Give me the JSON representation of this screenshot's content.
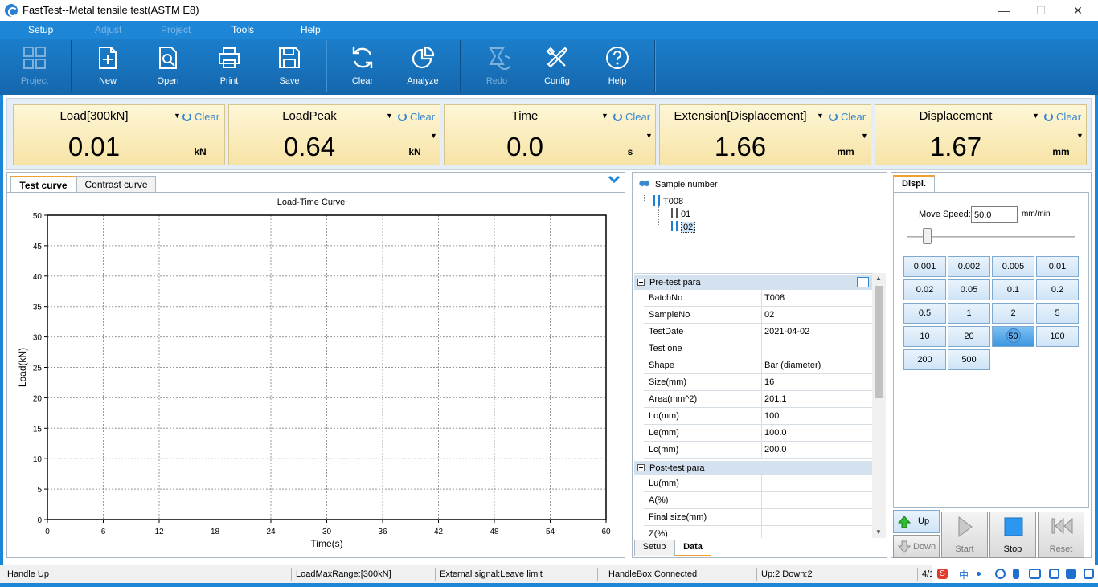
{
  "window": {
    "title": "FastTest--Metal tensile test(ASTM E8)",
    "minimize": "—",
    "maximize": "☐",
    "close": "✕"
  },
  "menu": [
    {
      "label": "Setup",
      "enabled": true
    },
    {
      "label": "Adjust",
      "enabled": false
    },
    {
      "label": "Project",
      "enabled": false
    },
    {
      "label": "Tools",
      "enabled": true
    },
    {
      "label": "Help",
      "enabled": true
    }
  ],
  "toolbar": {
    "project": "Project",
    "new": "New",
    "open": "Open",
    "print": "Print",
    "save": "Save",
    "clear": "Clear",
    "analyze": "Analyze",
    "redo": "Redo",
    "config": "Config",
    "help": "Help"
  },
  "meters": [
    {
      "name": "Load[300kN]",
      "value": "0.01",
      "unit": "kN",
      "clear": "Clear"
    },
    {
      "name": "LoadPeak",
      "value": "0.64",
      "unit": "kN",
      "clear": "Clear"
    },
    {
      "name": "Time",
      "value": "0.0",
      "unit": "s",
      "clear": "Clear"
    },
    {
      "name": "Extension[Displacement]",
      "value": "1.66",
      "unit": "mm",
      "clear": "Clear"
    },
    {
      "name": "Displacement",
      "value": "1.67",
      "unit": "mm",
      "clear": "Clear"
    }
  ],
  "chart_tabs": {
    "test_curve": "Test curve",
    "contrast_curve": "Contrast curve"
  },
  "chart_data": {
    "type": "line",
    "title": "Load-Time Curve",
    "xlabel": "Time(s)",
    "ylabel": "Load(kN)",
    "xlim": [
      0,
      60
    ],
    "ylim": [
      0,
      50
    ],
    "xticks": [
      0,
      6,
      12,
      18,
      24,
      30,
      36,
      42,
      48,
      54,
      60
    ],
    "yticks": [
      0,
      5,
      10,
      15,
      20,
      25,
      30,
      35,
      40,
      45,
      50
    ],
    "grid": true,
    "series": []
  },
  "sample_tree": {
    "root": "Sample number",
    "batch": "T008",
    "samples": [
      "01",
      "02"
    ],
    "selected": "02"
  },
  "pretest": {
    "title": "Pre-test para",
    "rows": [
      {
        "key": "BatchNo",
        "value": "T008"
      },
      {
        "key": "SampleNo",
        "value": "02"
      },
      {
        "key": "TestDate",
        "value": "2021-04-02"
      },
      {
        "key": "Test one",
        "value": ""
      },
      {
        "key": "Shape",
        "value": "Bar (diameter)"
      },
      {
        "key": "Size(mm)",
        "value": "16"
      },
      {
        "key": "Area(mm^2)",
        "value": "201.1"
      },
      {
        "key": "Lo(mm)",
        "value": "100"
      },
      {
        "key": "Le(mm)",
        "value": "100.0"
      },
      {
        "key": "Lc(mm)",
        "value": "200.0"
      }
    ]
  },
  "posttest": {
    "title": "Post-test para",
    "rows": [
      {
        "key": "Lu(mm)",
        "value": ""
      },
      {
        "key": "A(%)",
        "value": ""
      },
      {
        "key": "Final size(mm)",
        "value": ""
      },
      {
        "key": "Z(%)",
        "value": ""
      }
    ]
  },
  "mid_tabs": {
    "setup": "Setup",
    "data": "Data"
  },
  "displ": {
    "tab": "Displ.",
    "speed_label": "Move Speed:",
    "speed_value": "50.0",
    "speed_unit": "mm/min",
    "speed_slider": 0.1,
    "presets": [
      "0.001",
      "0.002",
      "0.005",
      "0.01",
      "0.02",
      "0.05",
      "0.1",
      "0.2",
      "0.5",
      "1",
      "2",
      "5",
      "10",
      "20",
      "50",
      "100",
      "200",
      "500"
    ],
    "selected": "50"
  },
  "controls": {
    "up": "Up",
    "down": "Down",
    "start": "Start",
    "stop": "Stop",
    "reset": "Reset"
  },
  "status": {
    "handle": "Handle Up",
    "range": "LoadMaxRange:[300kN]",
    "signal": "External signal:Leave limit",
    "handlebox": "HandleBox Connected",
    "updown": "Up:2 Down:2",
    "page": "4/1"
  },
  "tray": {
    "ime_badge": "S",
    "ime_lang": "中"
  },
  "colors": {
    "menubar": "#1e86d6",
    "toolbar": "#1572bd",
    "meter_bg": "#f9ebb9",
    "accent": "#3a88d0",
    "selected_preset": "#4ba3ea"
  }
}
